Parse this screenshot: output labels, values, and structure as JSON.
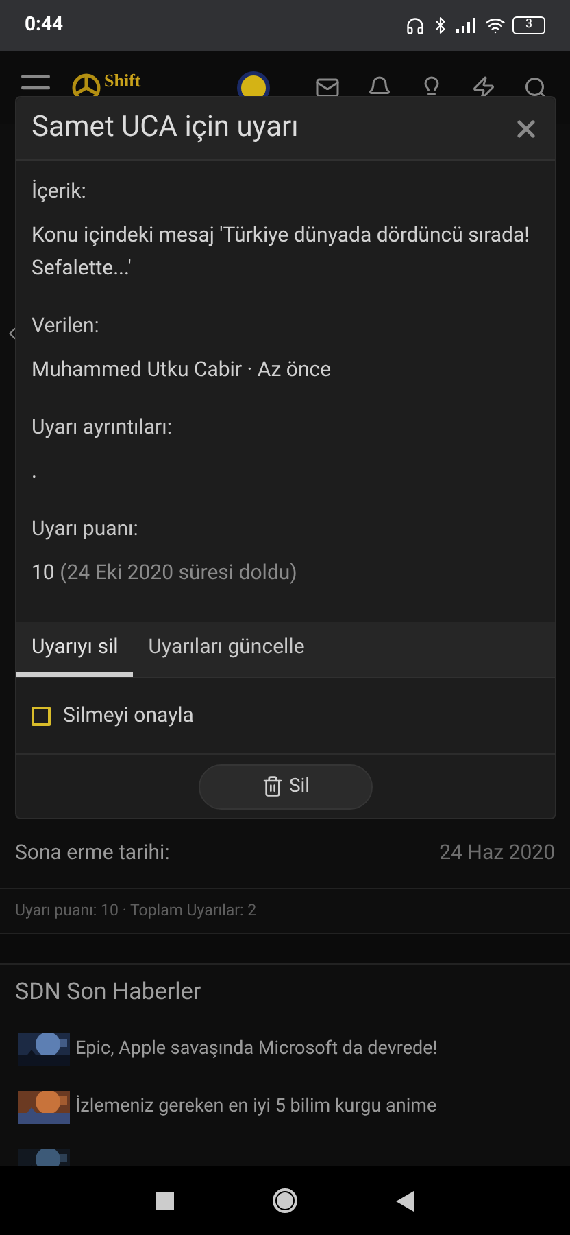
{
  "status_bar": {
    "time": "0:44",
    "battery": "3"
  },
  "header": {
    "logo_text": "Shift"
  },
  "dialog": {
    "title": "Samet UCA için uyarı",
    "fields": [
      {
        "label": "İçerik:",
        "value": "Konu içindeki mesaj 'Türkiye dünyada dördüncü sırada! Sefalette...'"
      },
      {
        "label": "Verilen:",
        "value": "Muhammed Utku Cabir · Az önce"
      },
      {
        "label": "Uyarı ayrıntıları:",
        "value": "."
      },
      {
        "label": "Uyarı puanı:",
        "value": "10",
        "note": "(24 Eki 2020 süresi doldu)"
      }
    ],
    "tabs": [
      {
        "label": "Uyarıyı sil",
        "selected": true
      },
      {
        "label": "Uyarıları güncelle",
        "selected": false
      }
    ],
    "confirm": {
      "label": "Silmeyi onayla",
      "checked": false
    },
    "button": "Sil"
  },
  "page": {
    "expiry_label": "Sona erme tarihi:",
    "expiry_value": "24 Haz 2020",
    "summary": "Uyarı puanı: 10 · Toplam Uyarılar: 2",
    "news_title": "SDN Son Haberler",
    "news": [
      {
        "title": "Epic, Apple savaşında Microsoft da devrede!"
      },
      {
        "title": "İzlemeniz gereken en iyi 5 bilim kurgu anime"
      }
    ]
  }
}
